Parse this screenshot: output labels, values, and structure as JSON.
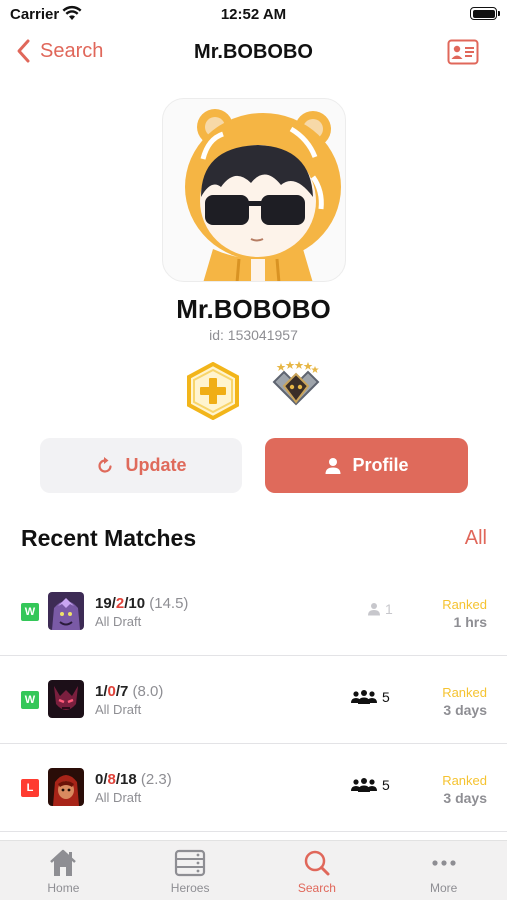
{
  "status_bar": {
    "carrier": "Carrier",
    "time": "12:52 AM"
  },
  "nav": {
    "back_label": "Search",
    "title": "Mr.BOBOBO"
  },
  "player": {
    "name": "Mr.BOBOBO",
    "id_text": "id: 153041957"
  },
  "actions": {
    "update_label": "Update",
    "profile_label": "Profile"
  },
  "recent": {
    "title": "Recent Matches",
    "all_label": "All"
  },
  "matches": [
    {
      "result": "W",
      "kills": "19",
      "deaths": "2",
      "assists": "10",
      "score": "(14.5)",
      "mode": "All Draft",
      "party_size": "1",
      "party_type": "solo",
      "lobby": "Ranked",
      "ago": "1 hrs",
      "hero_icon": "faceless-void-icon"
    },
    {
      "result": "W",
      "kills": "1",
      "deaths": "0",
      "assists": "7",
      "score": "(8.0)",
      "mode": "All Draft",
      "party_size": "5",
      "party_type": "group",
      "lobby": "Ranked",
      "ago": "3 days",
      "hero_icon": "shadow-demon-icon"
    },
    {
      "result": "L",
      "kills": "0",
      "deaths": "8",
      "assists": "18",
      "score": "(2.3)",
      "mode": "All Draft",
      "party_size": "5",
      "party_type": "group",
      "lobby": "Ranked",
      "ago": "3 days",
      "hero_icon": "bloodseeker-icon"
    }
  ],
  "tabs": [
    {
      "label": "Home",
      "icon": "home-icon",
      "active": false
    },
    {
      "label": "Heroes",
      "icon": "heroes-icon",
      "active": false
    },
    {
      "label": "Search",
      "icon": "search-icon",
      "active": true
    },
    {
      "label": "More",
      "icon": "more-icon",
      "active": false
    }
  ],
  "colors": {
    "accent": "#df6a5b",
    "win": "#34c759",
    "loss": "#ff3b30",
    "ranked": "#f5c331"
  }
}
